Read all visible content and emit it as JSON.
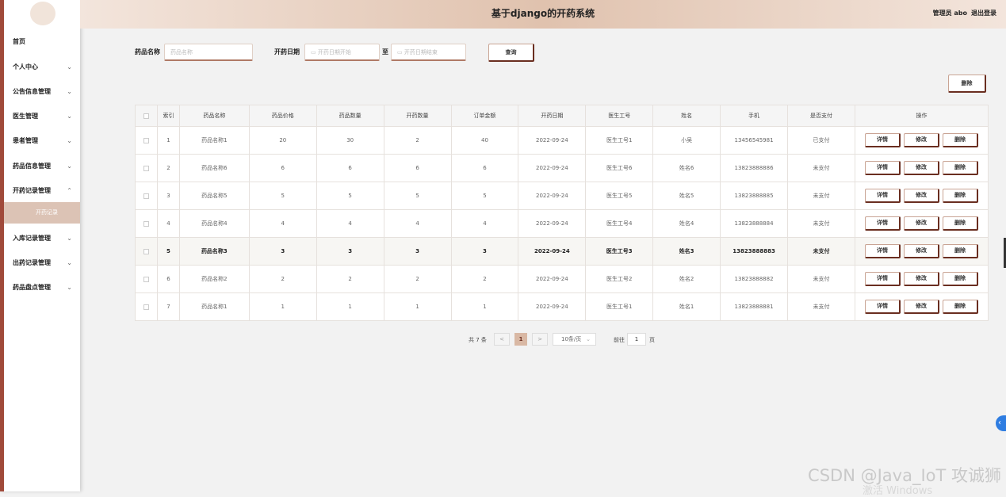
{
  "header": {
    "title": "基于django的开药系统",
    "user_label": "管理员 abo",
    "logout_label": "退出登录"
  },
  "sidebar": {
    "items": [
      {
        "label": "首页",
        "chevron": ""
      },
      {
        "label": "个人中心",
        "chevron": "⌄"
      },
      {
        "label": "公告信息管理",
        "chevron": "⌄"
      },
      {
        "label": "医生管理",
        "chevron": "⌄"
      },
      {
        "label": "患者管理",
        "chevron": "⌄"
      },
      {
        "label": "药品信息管理",
        "chevron": "⌄"
      },
      {
        "label": "开药记录管理",
        "chevron": "⌃"
      },
      {
        "label": "入库记录管理",
        "chevron": "⌄"
      },
      {
        "label": "出药记录管理",
        "chevron": "⌄"
      },
      {
        "label": "药品盘点管理",
        "chevron": "⌄"
      }
    ],
    "sub_item": "开药记录"
  },
  "search": {
    "drug_name_label": "药品名称",
    "drug_name_placeholder": "药品名称",
    "date_label": "开药日期",
    "date_start_placeholder": "开药日期开始",
    "date_sep": "至",
    "date_end_placeholder": "开药日期结束",
    "query_label": "查询"
  },
  "delete_label": "删除",
  "table": {
    "headers": [
      "索引",
      "药品名称",
      "药品价格",
      "药品数量",
      "开药数量",
      "订单金额",
      "开药日期",
      "医生工号",
      "姓名",
      "手机",
      "是否支付",
      "操作"
    ],
    "rows": [
      [
        "1",
        "药品名称1",
        "20",
        "30",
        "2",
        "40",
        "2022-09-24",
        "医生工号1",
        "小吴",
        "13456545981",
        "已支付"
      ],
      [
        "2",
        "药品名称6",
        "6",
        "6",
        "6",
        "6",
        "2022-09-24",
        "医生工号6",
        "姓名6",
        "13823888886",
        "未支付"
      ],
      [
        "3",
        "药品名称5",
        "5",
        "5",
        "5",
        "5",
        "2022-09-24",
        "医生工号5",
        "姓名5",
        "13823888885",
        "未支付"
      ],
      [
        "4",
        "药品名称4",
        "4",
        "4",
        "4",
        "4",
        "2022-09-24",
        "医生工号4",
        "姓名4",
        "13823888884",
        "未支付"
      ],
      [
        "5",
        "药品名称3",
        "3",
        "3",
        "3",
        "3",
        "2022-09-24",
        "医生工号3",
        "姓名3",
        "13823888883",
        "未支付"
      ],
      [
        "6",
        "药品名称2",
        "2",
        "2",
        "2",
        "2",
        "2022-09-24",
        "医生工号2",
        "姓名2",
        "13823888882",
        "未支付"
      ],
      [
        "7",
        "药品名称1",
        "1",
        "1",
        "1",
        "1",
        "2022-09-24",
        "医生工号1",
        "姓名1",
        "13823888881",
        "未支付"
      ]
    ],
    "actions": {
      "detail": "详情",
      "edit": "修改",
      "delete": "删除"
    }
  },
  "pagination": {
    "total": "共 7 条",
    "prev": "<",
    "current": "1",
    "next": ">",
    "page_size": "10条/页",
    "goto_label": "前往",
    "goto_value": "1",
    "page_suffix": "页"
  },
  "watermark": {
    "text": "CSDN @Java_IoT 攻诚狮",
    "activate": "激活 Windows"
  }
}
